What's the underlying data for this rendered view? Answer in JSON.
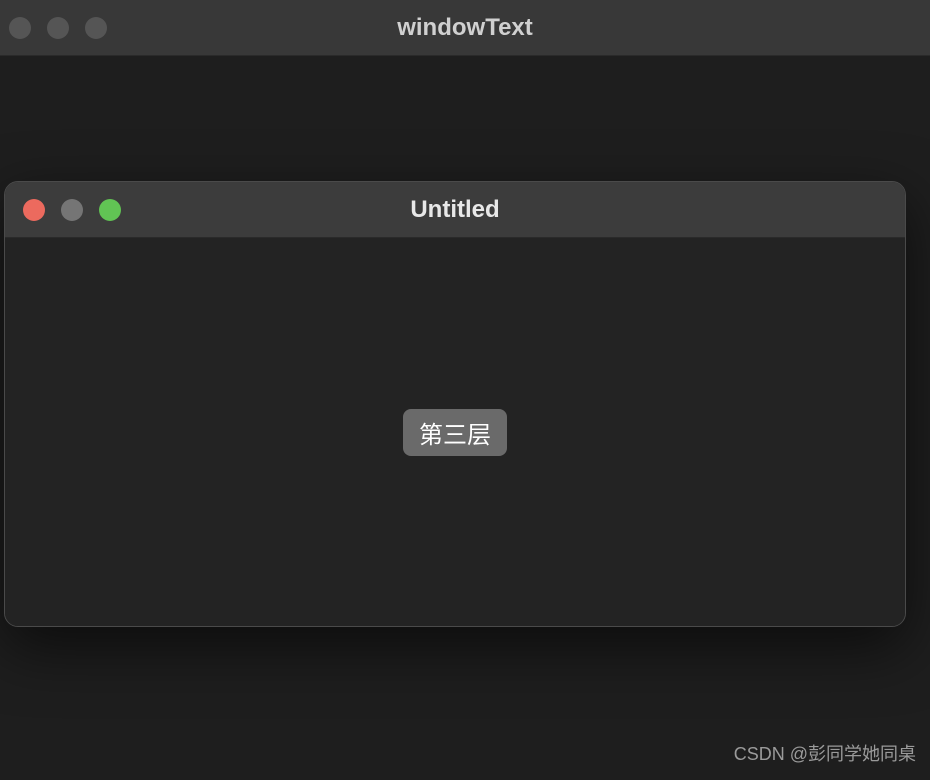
{
  "outer_window": {
    "title": "windowText"
  },
  "inner_window": {
    "title": "Untitled",
    "button_label": "第三层"
  },
  "watermark": "CSDN @彭同学她同桌"
}
